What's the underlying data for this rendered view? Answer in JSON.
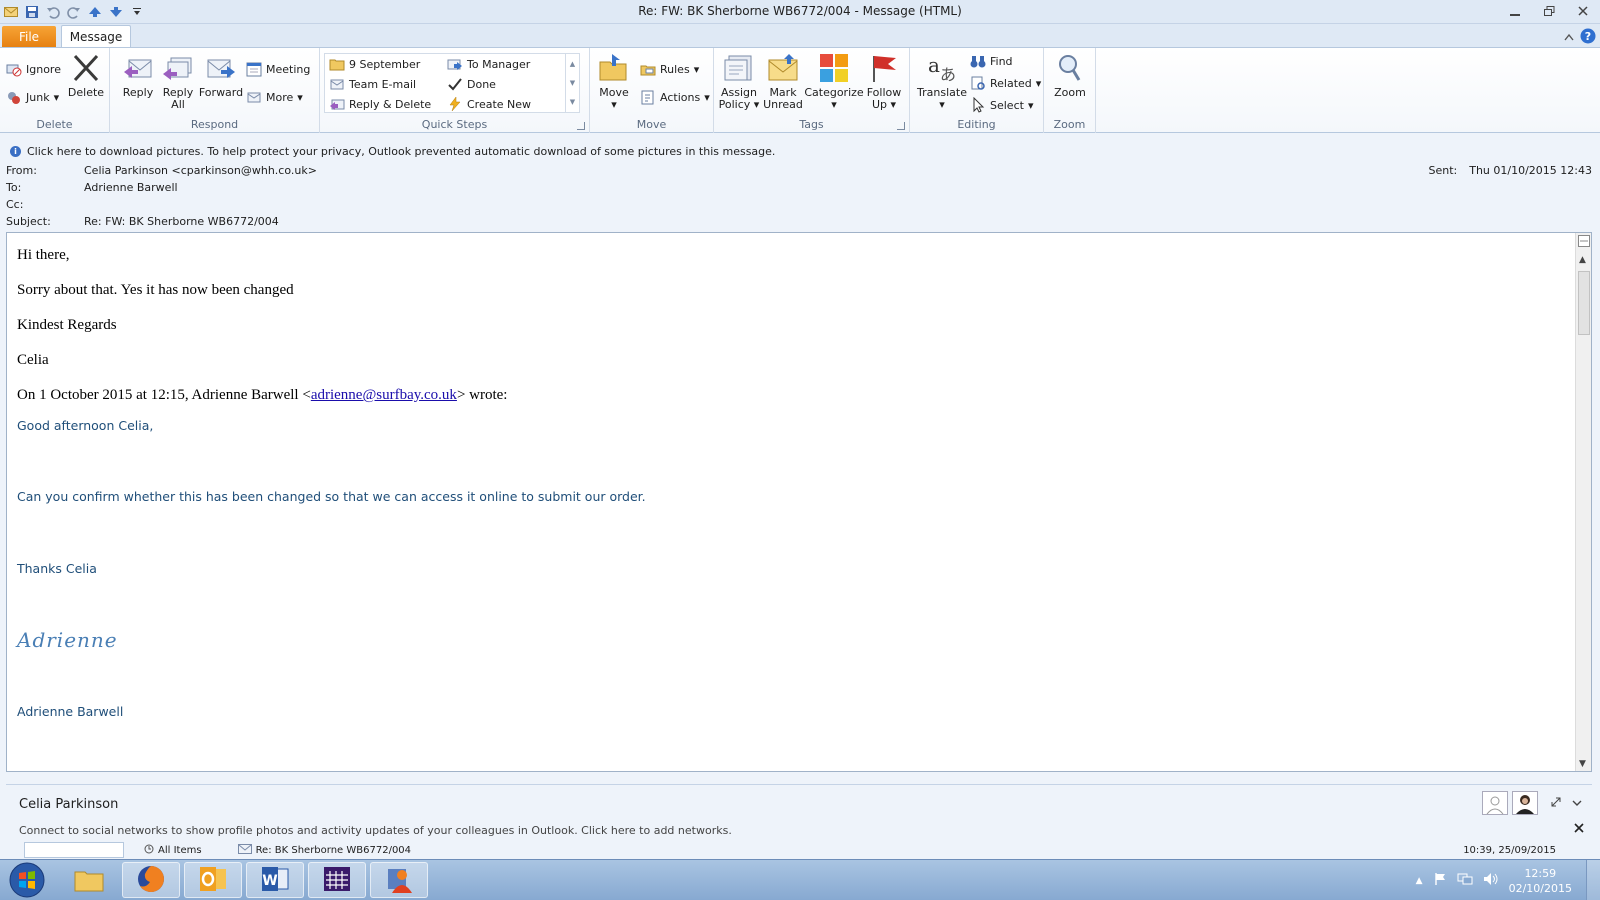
{
  "window": {
    "title": "Re: FW: BK Sherborne WB6772/004  -  Message (HTML)"
  },
  "tabs": {
    "file": "File",
    "message": "Message"
  },
  "ribbon": {
    "delete_group": {
      "label": "Delete",
      "ignore": "Ignore",
      "junk": "Junk",
      "delete": "Delete"
    },
    "respond_group": {
      "label": "Respond",
      "reply": "Reply",
      "reply_all_1": "Reply",
      "reply_all_2": "All",
      "forward": "Forward",
      "meeting": "Meeting",
      "more": "More"
    },
    "quick_steps_group": {
      "label": "Quick Steps",
      "items": [
        "9 September",
        "Team E-mail",
        "Reply & Delete",
        "To Manager",
        "Done",
        "Create New"
      ]
    },
    "move_group": {
      "label": "Move",
      "move": "Move",
      "rules": "Rules",
      "actions": "Actions"
    },
    "tags_group": {
      "label": "Tags",
      "assign_1": "Assign",
      "assign_2": "Policy",
      "mark_1": "Mark",
      "mark_2": "Unread",
      "categorize": "Categorize",
      "follow_1": "Follow",
      "follow_2": "Up"
    },
    "editing_group": {
      "label": "Editing",
      "translate": "Translate",
      "find": "Find",
      "related": "Related",
      "select": "Select"
    },
    "zoom_group": {
      "label": "Zoom",
      "zoom": "Zoom"
    }
  },
  "infobar": {
    "text": "Click here to download pictures. To help protect your privacy, Outlook prevented automatic download of some pictures in this message."
  },
  "header": {
    "from_label": "From:",
    "from_value": "Celia Parkinson <cparkinson@whh.co.uk>",
    "to_label": "To:",
    "to_value": "Adrienne Barwell",
    "cc_label": "Cc:",
    "cc_value": "",
    "subject_label": "Subject:",
    "subject_value": "Re: FW: BK Sherborne WB6772/004",
    "sent_label": "Sent:",
    "sent_value": "Thu 01/10/2015 12:43"
  },
  "body": {
    "greeting": "Hi there,",
    "line1": "Sorry about that. Yes it has now been changed",
    "regards": "Kindest Regards",
    "name": "Celia",
    "quote_prefix": "On 1 October 2015 at 12:15, Adrienne Barwell <",
    "quote_email": "adrienne@surfbay.co.uk",
    "quote_suffix": "> wrote:",
    "q_greeting": "Good afternoon Celia,",
    "q_line1": "Can you confirm whether this has been changed so that we can access it online to submit our order.",
    "q_thanks": "Thanks Celia",
    "q_signature": "Adrienne",
    "q_fullname": "Adrienne Barwell"
  },
  "people_pane": {
    "name": "Celia Parkinson",
    "note": "Connect to social networks to show profile photos and activity updates of your colleagues in Outlook. Click here to add networks.",
    "tab_all_items": "All Items",
    "item_subject": "Re: BK Sherborne WB6772/004",
    "item_date": "10:39, 25/09/2015"
  },
  "taskbar": {
    "time": "12:59",
    "date": "02/10/2015"
  },
  "colors": {
    "accent_file_tab": "#e57f10",
    "quoted_text": "#1f4e79",
    "link": "#1a0dab"
  }
}
